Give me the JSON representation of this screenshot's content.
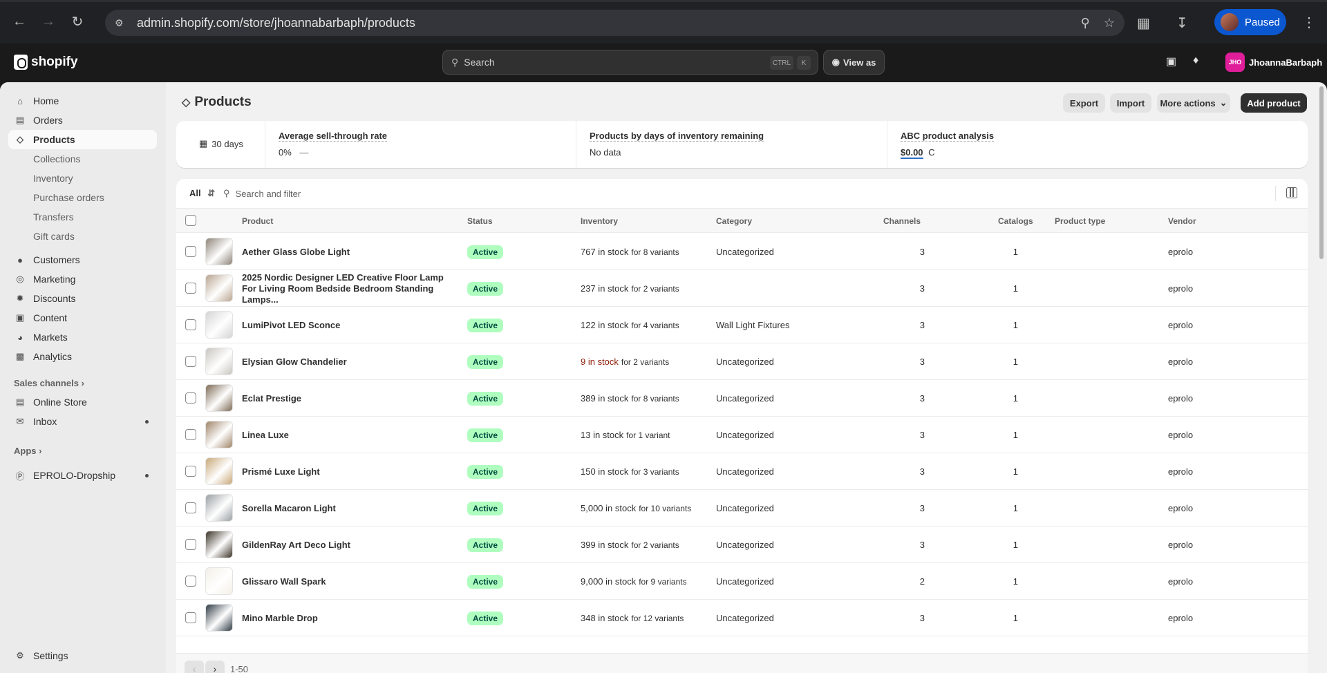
{
  "browser": {
    "url": "admin.shopify.com/store/jhoannabarbaph/products",
    "profile_status": "Paused"
  },
  "topbar": {
    "brand": "shopify",
    "search_placeholder": "Search",
    "shortcut_ctrl": "CTRL",
    "shortcut_k": "K",
    "view_as": "View as",
    "store_initials": "JHO",
    "store_name": "JhoannaBarbaph"
  },
  "sidebar": {
    "items": [
      {
        "label": "Home",
        "icon": "home-icon"
      },
      {
        "label": "Orders",
        "icon": "orders-icon"
      },
      {
        "label": "Products",
        "icon": "tag-icon"
      },
      {
        "label": "Collections"
      },
      {
        "label": "Inventory"
      },
      {
        "label": "Purchase orders"
      },
      {
        "label": "Transfers"
      },
      {
        "label": "Gift cards"
      },
      {
        "label": "Customers",
        "icon": "person-icon"
      },
      {
        "label": "Marketing",
        "icon": "target-icon"
      },
      {
        "label": "Discounts",
        "icon": "discount-icon"
      },
      {
        "label": "Content",
        "icon": "content-icon"
      },
      {
        "label": "Markets",
        "icon": "globe-icon"
      },
      {
        "label": "Analytics",
        "icon": "chart-icon"
      }
    ],
    "sales_channels_label": "Sales channels",
    "channels": [
      {
        "label": "Online Store"
      },
      {
        "label": "Inbox"
      }
    ],
    "apps_label": "Apps",
    "apps": [
      {
        "label": "EPROLO-Dropship"
      }
    ],
    "settings_label": "Settings"
  },
  "header": {
    "title": "Products",
    "export": "Export",
    "import": "Import",
    "more_actions": "More actions",
    "add_product": "Add product"
  },
  "metrics": {
    "period": "30 days",
    "sell_through_label": "Average sell-through rate",
    "sell_through_value": "0%",
    "sell_through_trend": "—",
    "days_inventory_label": "Products by days of inventory remaining",
    "days_inventory_value": "No data",
    "abc_label": "ABC product analysis",
    "abc_value": "$0.00",
    "abc_grade": "C"
  },
  "filter": {
    "view": "All",
    "search_placeholder": "Search and filter"
  },
  "table": {
    "columns": [
      "Product",
      "Status",
      "Inventory",
      "Category",
      "Channels",
      "Catalogs",
      "Product type",
      "Vendor"
    ],
    "rows": [
      {
        "product": "Aether Glass Globe Light",
        "status": "Active",
        "stock": "767 in stock",
        "variants": "for 8 variants",
        "category": "Uncategorized",
        "channels": "3",
        "catalogs": "1",
        "type": "",
        "vendor": "eprolo",
        "thumb": "#8d8478"
      },
      {
        "product": "2025 Nordic Designer LED Creative Floor Lamp For Living Room Bedside Bedroom Standing Lamps...",
        "status": "Active",
        "stock": "237 in stock",
        "variants": "for 2 variants",
        "category": "",
        "channels": "3",
        "catalogs": "1",
        "type": "",
        "vendor": "eprolo",
        "thumb": "#b9a58f"
      },
      {
        "product": "LumiPivot LED Sconce",
        "status": "Active",
        "stock": "122 in stock",
        "variants": "for 4 variants",
        "category": "Wall Light Fixtures",
        "channels": "3",
        "catalogs": "1",
        "type": "",
        "vendor": "eprolo",
        "thumb": "#d4d4d4"
      },
      {
        "product": "Elysian Glow Chandelier",
        "status": "Active",
        "stock": "9 in stock",
        "variants": "for 2 variants",
        "category": "Uncategorized",
        "channels": "3",
        "catalogs": "1",
        "type": "",
        "vendor": "eprolo",
        "thumb": "#c9c6c0",
        "low": true
      },
      {
        "product": "Eclat Prestige",
        "status": "Active",
        "stock": "389 in stock",
        "variants": "for 8 variants",
        "category": "Uncategorized",
        "channels": "3",
        "catalogs": "1",
        "type": "",
        "vendor": "eprolo",
        "thumb": "#7d6a55"
      },
      {
        "product": "Linea Luxe",
        "status": "Active",
        "stock": "13 in stock",
        "variants": "for 1 variant",
        "category": "Uncategorized",
        "channels": "3",
        "catalogs": "1",
        "type": "",
        "vendor": "eprolo",
        "thumb": "#a08468"
      },
      {
        "product": "Prismé Luxe Light",
        "status": "Active",
        "stock": "150 in stock",
        "variants": "for 3 variants",
        "category": "Uncategorized",
        "channels": "3",
        "catalogs": "1",
        "type": "",
        "vendor": "eprolo",
        "thumb": "#c8a878"
      },
      {
        "product": "Sorella Macaron Light",
        "status": "Active",
        "stock": "5,000 in stock",
        "variants": "for 10 variants",
        "category": "Uncategorized",
        "channels": "3",
        "catalogs": "1",
        "type": "",
        "vendor": "eprolo",
        "thumb": "#9aa0a4"
      },
      {
        "product": "GildenRay Art Deco Light",
        "status": "Active",
        "stock": "399 in stock",
        "variants": "for 2 variants",
        "category": "Uncategorized",
        "channels": "3",
        "catalogs": "1",
        "type": "",
        "vendor": "eprolo",
        "thumb": "#3a3226"
      },
      {
        "product": "Glissaro Wall Spark",
        "status": "Active",
        "stock": "9,000 in stock",
        "variants": "for 9 variants",
        "category": "Uncategorized",
        "channels": "2",
        "catalogs": "1",
        "type": "",
        "vendor": "eprolo",
        "thumb": "#f2efe6"
      },
      {
        "product": "Mino Marble Drop",
        "status": "Active",
        "stock": "348 in stock",
        "variants": "for 12 variants",
        "category": "Uncategorized",
        "channels": "3",
        "catalogs": "1",
        "type": "",
        "vendor": "eprolo",
        "thumb": "#2f3a44"
      }
    ]
  },
  "pagination": {
    "range": "1-50"
  }
}
